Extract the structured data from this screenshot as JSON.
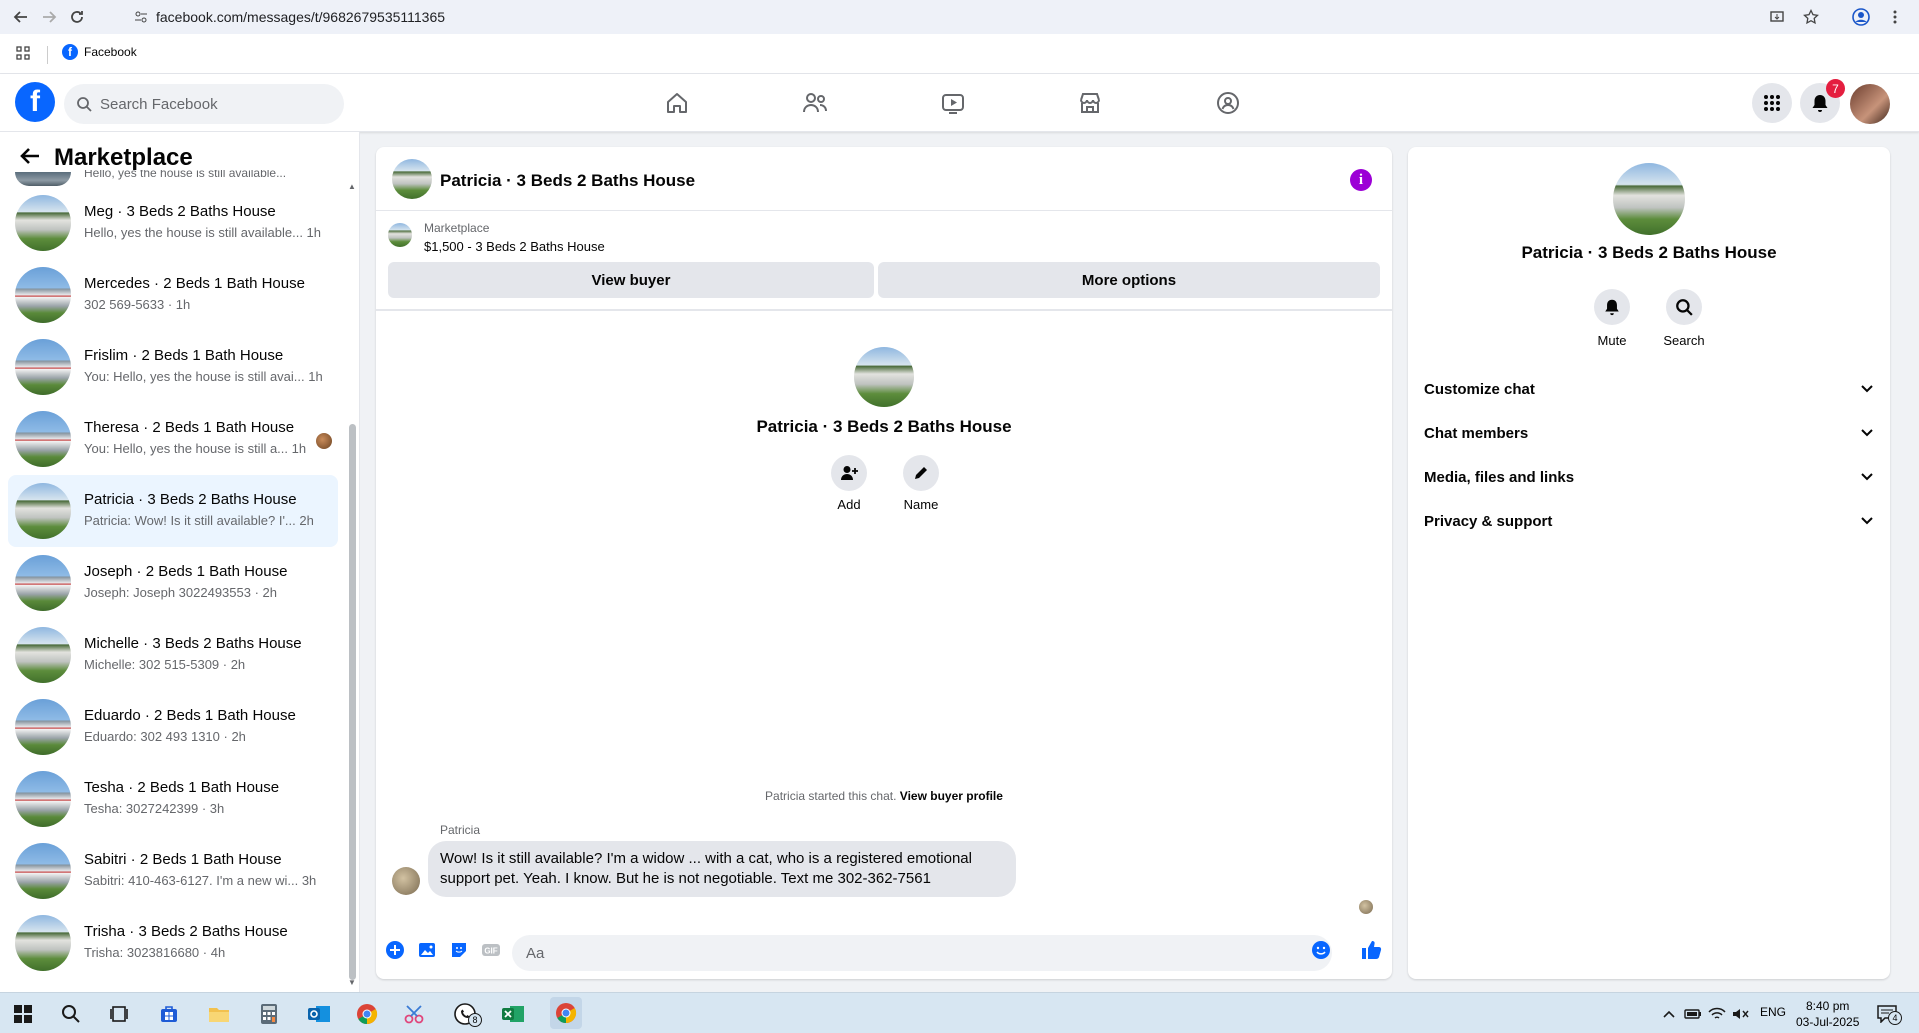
{
  "browser": {
    "url": "facebook.com/messages/t/9682679535111365",
    "bookmark_label": "Facebook"
  },
  "header": {
    "logo_letter": "f",
    "search_placeholder": "Search Facebook",
    "notification_count": "7"
  },
  "sidebar": {
    "title": "Marketplace",
    "top_preview": "Hello, yes the house is still available...",
    "conversations": [
      {
        "name": "Meg · 3 Beds 2 Baths House",
        "preview": "Hello, yes the house is still available...  1h",
        "house": "b"
      },
      {
        "name": "Mercedes · 2 Beds 1 Bath House",
        "preview": "302 569-5633 · 1h",
        "house": "a"
      },
      {
        "name": "Frislim · 2 Beds 1 Bath House",
        "preview": "You: Hello, yes the house is still avai...  1h",
        "house": "a"
      },
      {
        "name": "Theresa · 2 Beds 1 Bath House",
        "preview": "You: Hello, yes the house is still a...  1h",
        "house": "a"
      },
      {
        "name": "Patricia · 3 Beds 2 Baths House",
        "preview": "Patricia: Wow! Is it still available? I'...  2h",
        "house": "b"
      },
      {
        "name": "Joseph · 2 Beds 1 Bath House",
        "preview": "Joseph: Joseph 3022493553 · 2h",
        "house": "a"
      },
      {
        "name": "Michelle · 3 Beds 2 Baths House",
        "preview": "Michelle: 302 515-5309 · 2h",
        "house": "b"
      },
      {
        "name": "Eduardo · 2 Beds 1 Bath House",
        "preview": "Eduardo: 302 493 1310 · 2h",
        "house": "a"
      },
      {
        "name": "Tesha · 2 Beds 1 Bath House",
        "preview": "Tesha: 3027242399 · 3h",
        "house": "a"
      },
      {
        "name": "Sabitri · 2 Beds 1 Bath House",
        "preview": "Sabitri: 410-463-6127. I'm a new wi...  3h",
        "house": "a"
      },
      {
        "name": "Trisha · 3 Beds 2 Baths House",
        "preview": "Trisha: 3023816680 · 4h",
        "house": "b"
      }
    ]
  },
  "chat": {
    "title": "Patricia · 3 Beds 2 Baths House",
    "marketplace_label": "Marketplace",
    "listing": "$1,500 - 3 Beds 2 Baths House",
    "view_buyer": "View buyer",
    "more_options": "More options",
    "profile_name": "Patricia · 3 Beds 2 Baths House",
    "add_label": "Add",
    "name_label": "Name",
    "started_text": "Patricia started this chat.",
    "view_profile_link": "View buyer profile",
    "sender": "Patricia",
    "message": "Wow!  Is it still available?  I'm a widow ... with a cat, who is a registered emotional support pet.  Yeah.  I know.  But he is not negotiable.  Text me 302-362-7561",
    "composer_placeholder": "Aa"
  },
  "right_panel": {
    "name": "Patricia · 3 Beds 2 Baths House",
    "mute": "Mute",
    "search": "Search",
    "sections": [
      "Customize chat",
      "Chat members",
      "Media, files and links",
      "Privacy & support"
    ]
  },
  "taskbar": {
    "lang": "ENG",
    "time": "8:40 pm",
    "date": "03-Jul-2025",
    "whatsapp_count": "8",
    "notif_count": "4"
  }
}
